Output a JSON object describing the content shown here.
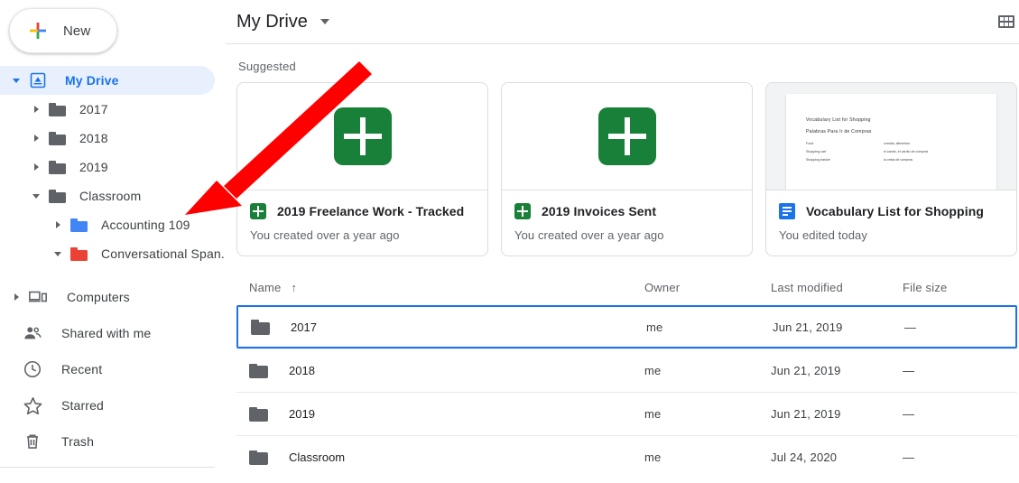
{
  "sidebar": {
    "new_button": {
      "label": "New",
      "icon": "google-plus-icon"
    },
    "tree": [
      {
        "label": "My Drive",
        "icon": "drive-icon",
        "level": 0,
        "expanded": true,
        "selected": true
      },
      {
        "label": "2017",
        "icon": "folder-icon",
        "level": 1,
        "expanded": false,
        "selected": false
      },
      {
        "label": "2018",
        "icon": "folder-icon",
        "level": 1,
        "expanded": false,
        "selected": false
      },
      {
        "label": "2019",
        "icon": "folder-icon",
        "level": 1,
        "expanded": false,
        "selected": false
      },
      {
        "label": "Classroom",
        "icon": "folder-icon",
        "level": 1,
        "expanded": true,
        "selected": false
      },
      {
        "label": "Accounting 109",
        "icon": "folder-icon-blue",
        "level": 2,
        "expanded": false,
        "selected": false
      },
      {
        "label": "Conversational Span...",
        "icon": "folder-icon-red",
        "level": 2,
        "expanded": true,
        "selected": false
      }
    ],
    "nav": [
      {
        "label": "Computers",
        "icon": "computers-icon",
        "caret": true
      },
      {
        "label": "Shared with me",
        "icon": "people-icon",
        "caret": false
      },
      {
        "label": "Recent",
        "icon": "clock-icon",
        "caret": false
      },
      {
        "label": "Starred",
        "icon": "star-icon",
        "caret": false
      },
      {
        "label": "Trash",
        "icon": "trash-icon",
        "caret": false
      }
    ]
  },
  "header": {
    "title": "My Drive",
    "dropdown_icon": "chevron-down-icon",
    "view_toggle_icon": "grid-view-icon"
  },
  "suggested": {
    "label": "Suggested",
    "cards": [
      {
        "title": "2019 Freelance Work - Tracked",
        "subtitle": "You created over a year ago",
        "icon": "sheets-icon",
        "thumb": "sheets-icon-large"
      },
      {
        "title": "2019 Invoices Sent",
        "subtitle": "You created over a year ago",
        "icon": "sheets-icon",
        "thumb": "sheets-icon-large"
      },
      {
        "title": "Vocabulary List for Shopping",
        "subtitle": "You edited today",
        "icon": "docs-icon",
        "thumb": "document-preview"
      }
    ]
  },
  "doc_preview": {
    "heading1": "Vocabulary List for Shopping",
    "heading2": "Palabras Para Ir de Compras",
    "rows": [
      {
        "en": "Food",
        "es": "comida, alimentos"
      },
      {
        "en": "Shopping cart",
        "es": "el carrito, el carrito de compras"
      },
      {
        "en": "Shopping basket",
        "es": "la cesta de compras"
      }
    ]
  },
  "file_table": {
    "columns": {
      "name": "Name",
      "owner": "Owner",
      "modified": "Last modified",
      "size": "File size"
    },
    "sort_icon": "↑",
    "rows": [
      {
        "name": "2017",
        "owner": "me",
        "modified": "Jun 21, 2019",
        "size": "—",
        "icon": "folder-icon",
        "selected": true
      },
      {
        "name": "2018",
        "owner": "me",
        "modified": "Jun 21, 2019",
        "size": "—",
        "icon": "folder-icon",
        "selected": false
      },
      {
        "name": "2019",
        "owner": "me",
        "modified": "Jun 21, 2019",
        "size": "—",
        "icon": "folder-icon",
        "selected": false
      },
      {
        "name": "Classroom",
        "owner": "me",
        "modified": "Jul 24, 2020",
        "size": "—",
        "icon": "folder-icon",
        "selected": false
      }
    ]
  },
  "annotation": {
    "type": "arrow",
    "color": "#FF0000",
    "points_to": "Accounting 109"
  },
  "colors": {
    "accent": "#1a73e8",
    "selected_bg": "#e8f0fe",
    "sheets_green": "#188038",
    "docs_blue": "#1a73e8",
    "folder_gray": "#5f6368",
    "folder_blue": "#4285f4",
    "folder_red": "#ea4335",
    "annotation_red": "#FF0000"
  }
}
